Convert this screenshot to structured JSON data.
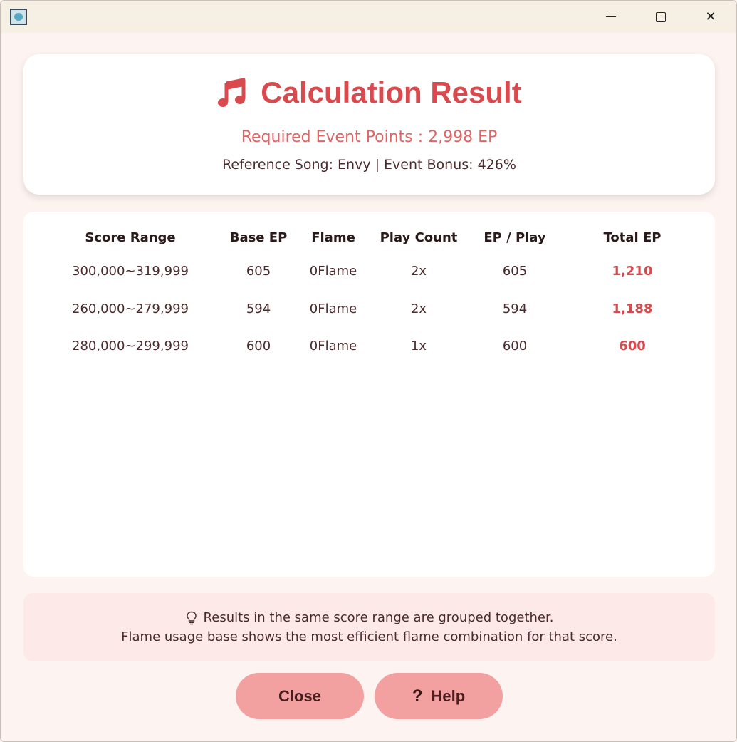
{
  "window": {
    "minimize_glyph": "",
    "close_glyph": "✕"
  },
  "header": {
    "title": "Calculation Result",
    "required": "Required Event Points : 2,998 EP",
    "reference": "Reference Song: Envy | Event Bonus:  426%"
  },
  "table": {
    "columns": [
      "Score Range",
      "Base EP",
      "Flame",
      "Play Count",
      "EP / Play",
      "Total EP"
    ],
    "rows": [
      {
        "range": "300,000~319,999",
        "base": "605",
        "flame": "0Flame",
        "count": "2x",
        "per_play": "605",
        "total": "1,210"
      },
      {
        "range": "260,000~279,999",
        "base": "594",
        "flame": "0Flame",
        "count": "2x",
        "per_play": "594",
        "total": "1,188"
      },
      {
        "range": "280,000~299,999",
        "base": "600",
        "flame": "0Flame",
        "count": "1x",
        "per_play": "600",
        "total": "600"
      }
    ]
  },
  "note": {
    "line1": "Results in the same score range are grouped together.",
    "line2": "Flame usage base shows the most efficient flame combination for that score."
  },
  "buttons": {
    "close": "Close",
    "help": "Help",
    "help_icon": "?"
  },
  "colors": {
    "accent": "#d94a4f",
    "button_bg": "#f2a0a0",
    "note_bg": "#fde9e7"
  }
}
